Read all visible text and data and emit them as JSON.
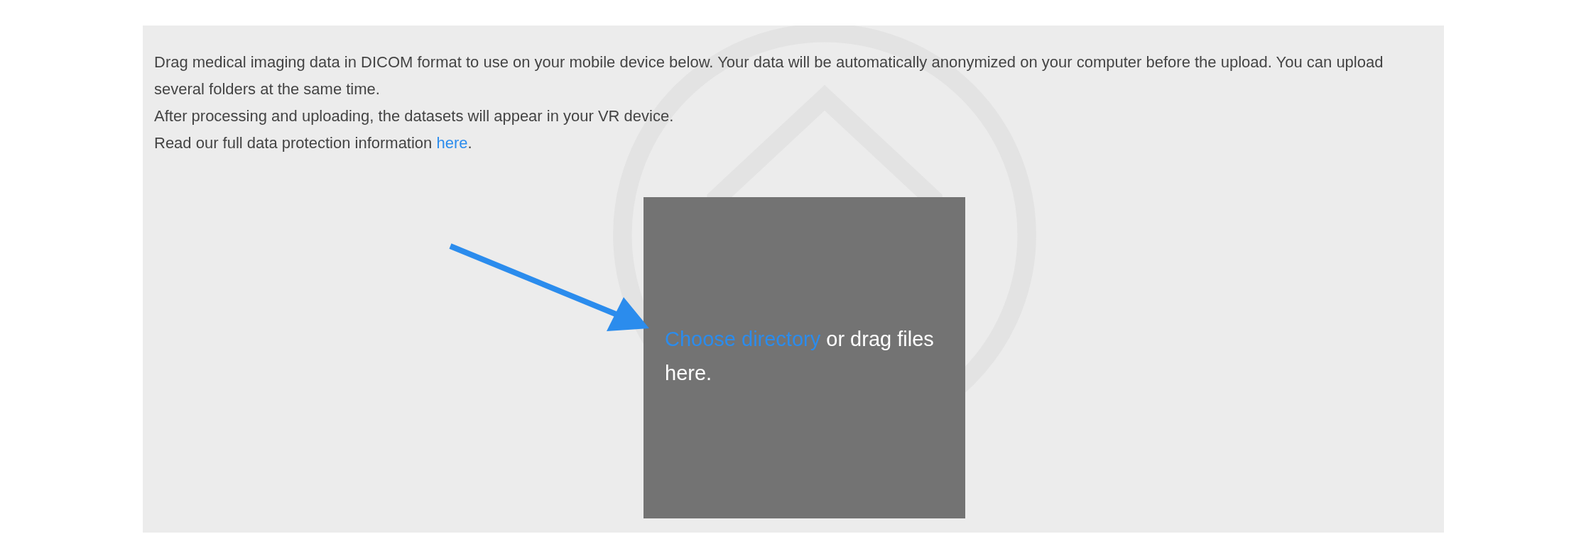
{
  "intro": {
    "paragraphs": [
      "Drag medical imaging data in DICOM format to use on your mobile device below. Your data will be automatically anonymized on your computer before the upload. You can upload several folders at the same time.",
      "After processing and uploading, the datasets will appear in your VR device."
    ],
    "privacy": {
      "text": "Read our full data protection information",
      "link": "here",
      "end": "."
    }
  },
  "dropzone": {
    "link": "Choose directory",
    "text": "or drag files here."
  }
}
